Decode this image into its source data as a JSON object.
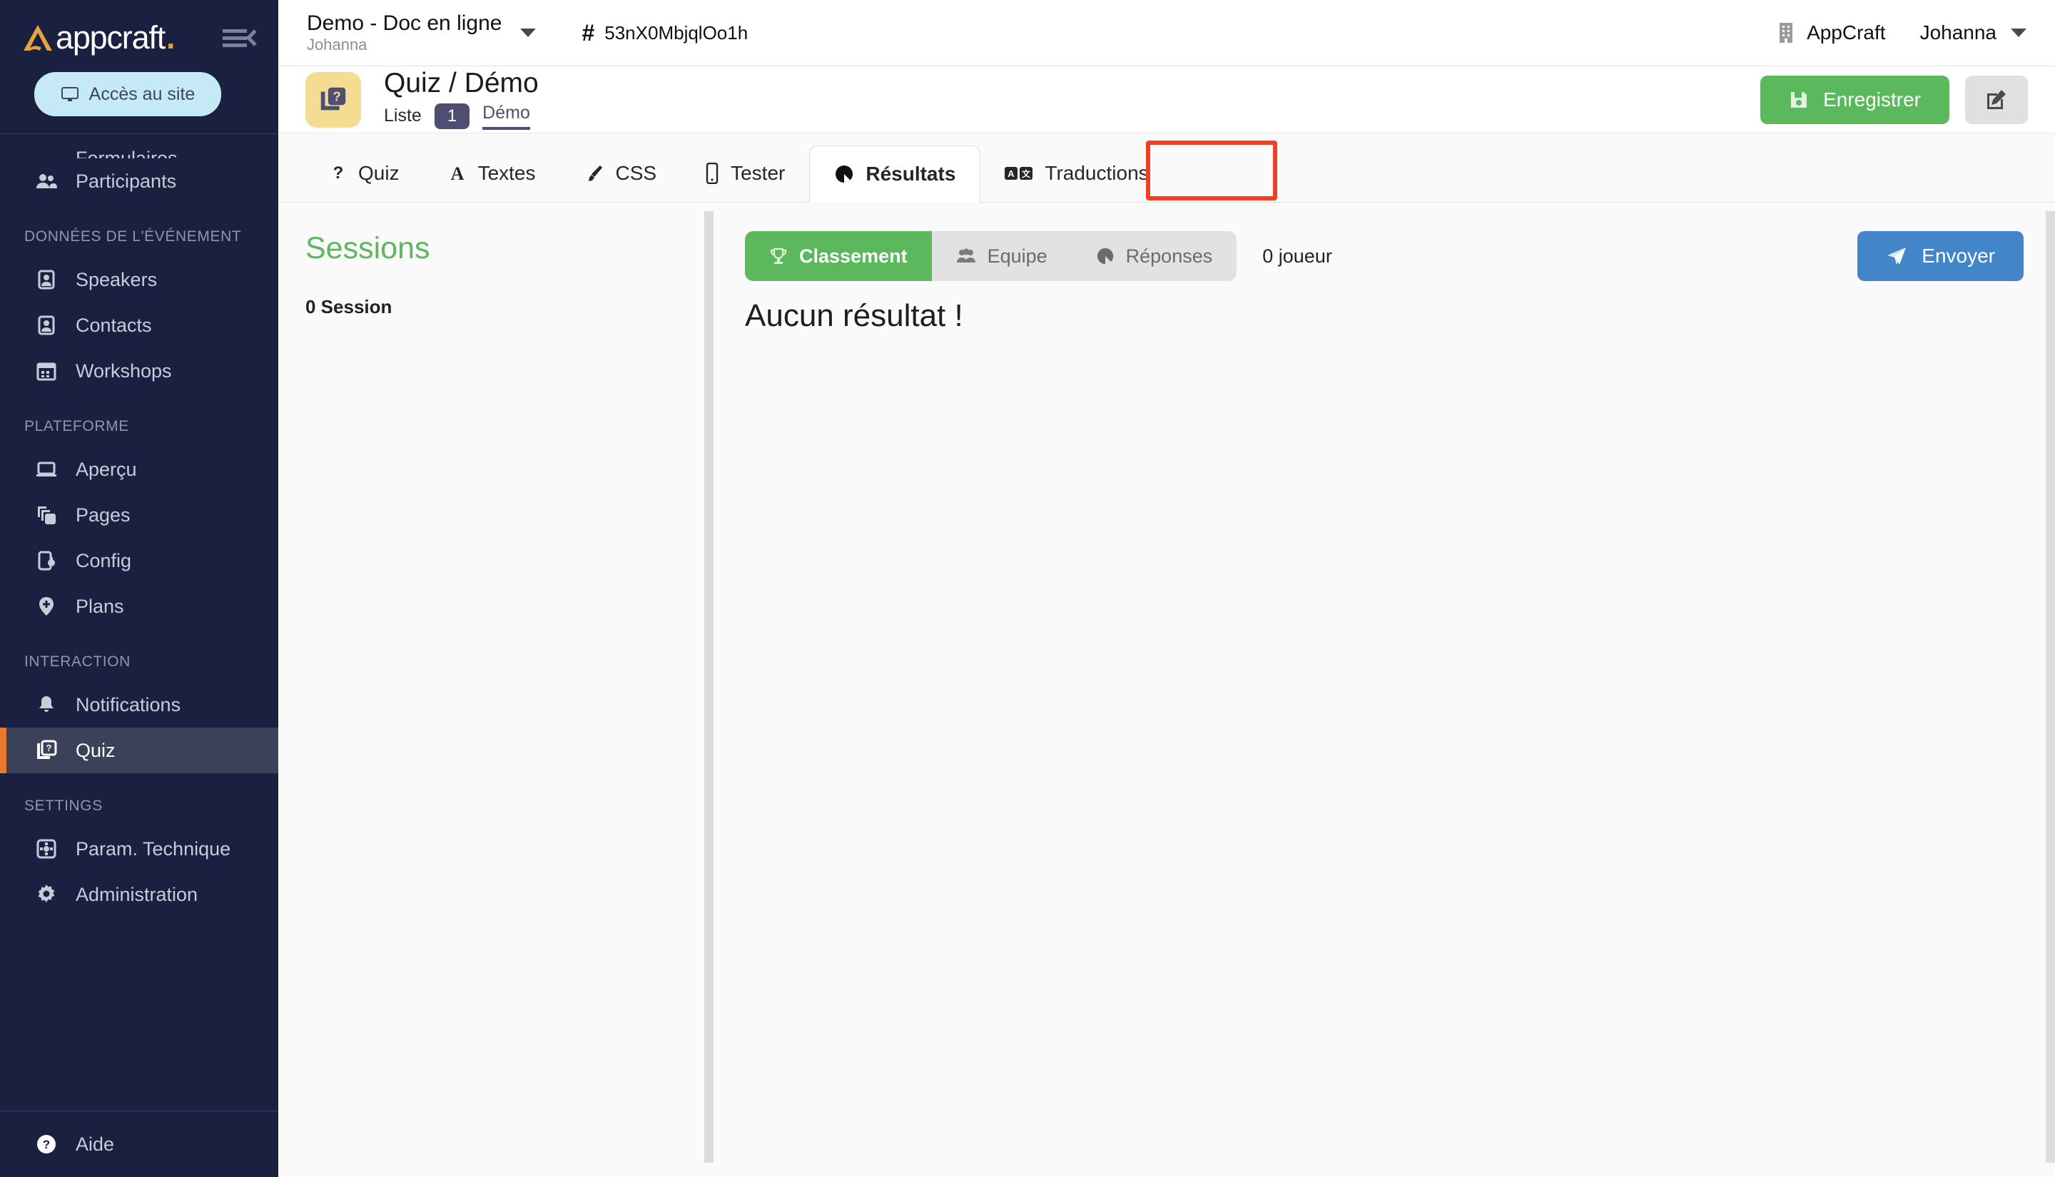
{
  "brand": {
    "name": "appcraft",
    "dot": ".",
    "accent_orange": "#E8792E",
    "sidebar_bg": "#1A2140",
    "active_bg": "#3A4159"
  },
  "sidebar": {
    "access_button": "Accès au site",
    "clipped_item": {
      "label": "Formulaires",
      "icon": "pencil-icon"
    },
    "items_top": [
      {
        "label": "Participants",
        "icon": "people-icon"
      }
    ],
    "sections": [
      {
        "title": "DONNÉES DE L'ÉVÉNEMENT",
        "items": [
          {
            "label": "Speakers",
            "icon": "badge-person-icon"
          },
          {
            "label": "Contacts",
            "icon": "badge-person-icon"
          },
          {
            "label": "Workshops",
            "icon": "calendar-icon"
          }
        ]
      },
      {
        "title": "PLATEFORME",
        "items": [
          {
            "label": "Aperçu",
            "icon": "laptop-icon"
          },
          {
            "label": "Pages",
            "icon": "copy-pages-icon"
          },
          {
            "label": "Config",
            "icon": "phone-gear-icon"
          },
          {
            "label": "Plans",
            "icon": "map-pin-icon"
          }
        ]
      },
      {
        "title": "INTERACTION",
        "items": [
          {
            "label": "Notifications",
            "icon": "bell-icon"
          },
          {
            "label": "Quiz",
            "icon": "quiz-cards-icon",
            "active": true
          }
        ]
      },
      {
        "title": "SETTINGS",
        "items": [
          {
            "label": "Param. Technique",
            "icon": "settings-square-icon"
          },
          {
            "label": "Administration",
            "icon": "gear-icon"
          }
        ]
      }
    ],
    "help": {
      "label": "Aide",
      "icon": "help-circle-icon"
    }
  },
  "topbar": {
    "event_name": "Demo - Doc en ligne",
    "event_owner": "Johanna",
    "hash": "#",
    "event_id": "53nX0MbjqlOo1h",
    "organization": "AppCraft",
    "user": "Johanna"
  },
  "pagehead": {
    "title": "Quiz / Démo",
    "crumb_list": "Liste",
    "crumb_count": "1",
    "crumb_current": "Démo",
    "save_label": "Enregistrer",
    "edit_icon": "edit-square-icon",
    "save_color": "#5CB85C"
  },
  "tabs": [
    {
      "label": "Quiz",
      "icon": "question-mark-icon",
      "selected": false
    },
    {
      "label": "Textes",
      "icon": "letter-a-icon",
      "selected": false
    },
    {
      "label": "CSS",
      "icon": "paintbrush-icon",
      "selected": false
    },
    {
      "label": "Tester",
      "icon": "mobile-icon",
      "selected": false
    },
    {
      "label": "Résultats",
      "icon": "pie-chart-icon",
      "selected": true
    },
    {
      "label": "Traductions",
      "icon": "translate-icon",
      "selected": false
    }
  ],
  "tab_highlight_color": "#EF4023",
  "sessions": {
    "title": "Sessions",
    "count_label": "0 Session"
  },
  "results": {
    "segments": [
      {
        "label": "Classement",
        "icon": "trophy-icon",
        "active": true
      },
      {
        "label": "Equipe",
        "icon": "group-icon",
        "active": false
      },
      {
        "label": "Réponses",
        "icon": "pie-chart-icon",
        "active": false
      }
    ],
    "players_label": "0 joueur",
    "send_label": "Envoyer",
    "send_icon": "paper-plane-icon",
    "empty_message": "Aucun résultat !",
    "send_color": "#4285C8"
  }
}
